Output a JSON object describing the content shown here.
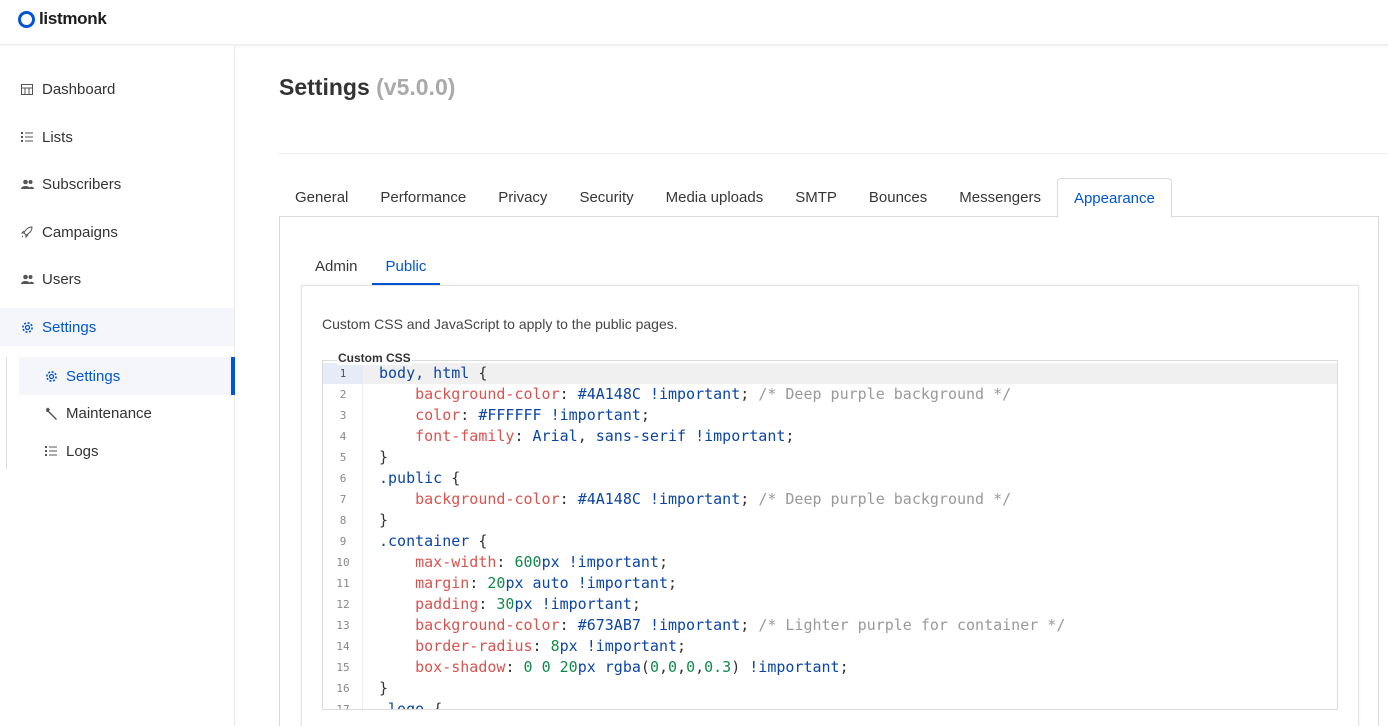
{
  "app": {
    "brand": "listmonk"
  },
  "sidebar": {
    "items": [
      {
        "label": "Dashboard",
        "icon": "dashboard-icon"
      },
      {
        "label": "Lists",
        "icon": "list-icon"
      },
      {
        "label": "Subscribers",
        "icon": "users-icon"
      },
      {
        "label": "Campaigns",
        "icon": "rocket-icon"
      },
      {
        "label": "Users",
        "icon": "users-icon"
      },
      {
        "label": "Settings",
        "icon": "gear-icon"
      }
    ],
    "sub_items": [
      {
        "label": "Settings",
        "icon": "gear-icon"
      },
      {
        "label": "Maintenance",
        "icon": "wrench-icon"
      },
      {
        "label": "Logs",
        "icon": "list-icon"
      }
    ]
  },
  "page": {
    "title": "Settings",
    "version": "(v5.0.0)"
  },
  "tabs": [
    "General",
    "Performance",
    "Privacy",
    "Security",
    "Media uploads",
    "SMTP",
    "Bounces",
    "Messengers",
    "Appearance"
  ],
  "subtabs": [
    "Admin",
    "Public"
  ],
  "panel": {
    "description": "Custom CSS and JavaScript to apply to the public pages.",
    "field_label": "Custom CSS"
  },
  "editor": {
    "line_numbers": [
      "1",
      "2",
      "3",
      "4",
      "5",
      "6",
      "7",
      "8",
      "9",
      "10",
      "11",
      "12",
      "13",
      "14",
      "15",
      "16",
      "17"
    ],
    "lines": [
      "body, html {",
      "    background-color: #4A148C !important; /* Deep purple background */",
      "    color: #FFFFFF !important;",
      "    font-family: Arial, sans-serif !important;",
      "}",
      ".public {",
      "    background-color: #4A148C !important; /* Deep purple background */",
      "}",
      ".container {",
      "    max-width: 600px !important;",
      "    margin: 20px auto !important;",
      "    padding: 30px !important;",
      "    background-color: #673AB7 !important; /* Lighter purple for container */",
      "    border-radius: 8px !important;",
      "    box-shadow: 0 0 20px rgba(0,0,0,0.3) !important;",
      "}",
      ".logo {"
    ]
  },
  "colors": {
    "accent": "#0055d4"
  }
}
